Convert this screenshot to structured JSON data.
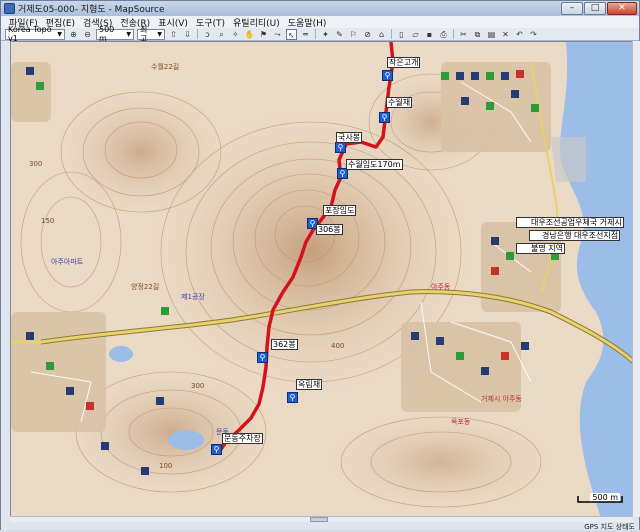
{
  "window": {
    "title": "거제도05-000- 지형도 - MapSource",
    "minimize": "–",
    "maximize": "□",
    "close": "✕"
  },
  "menu": [
    "파일(F)",
    "편집(E)",
    "검색(S)",
    "전송(R)",
    "표시(V)",
    "도구(T)",
    "유틸리티(U)",
    "도움말(H)"
  ],
  "toolbar": {
    "map_product": "Korea Topo v1",
    "zoom_scale": "500 m",
    "detail_level": "최고"
  },
  "route_labels": {
    "start_top": "작은고개",
    "pass1": "수월재",
    "peak1": "국사봉",
    "point170": "수월임도170m",
    "forest_road": "포장임도",
    "peak306": "306봉",
    "peak362": "362봉",
    "pass2": "옥림재",
    "end": "문동주차장"
  },
  "map_labels": {
    "shipyard": "대우조선공업우체국 거제시",
    "bank": "경남은행 대우조선지점",
    "unnamed_area": "불명 지역",
    "road1": "수월22길",
    "road2": "양정22길",
    "town1": "거제시 아주동",
    "town2": "아주동",
    "town3": "문동",
    "town4": "옥포동",
    "district": "제1공장",
    "apt1": "아주아파트",
    "contour_300a": "300",
    "contour_300b": "300",
    "contour_150": "150",
    "contour_100": "100",
    "contour_400": "400"
  },
  "map_status": {
    "scale": "500 m",
    "gps_text": "GPS 지도 상태도"
  },
  "colors": {
    "route": "#d4121e",
    "terrain": "#e8d7c2",
    "sea": "#9bbde8",
    "road": "#e9d16b",
    "contour": "#b98d63"
  }
}
